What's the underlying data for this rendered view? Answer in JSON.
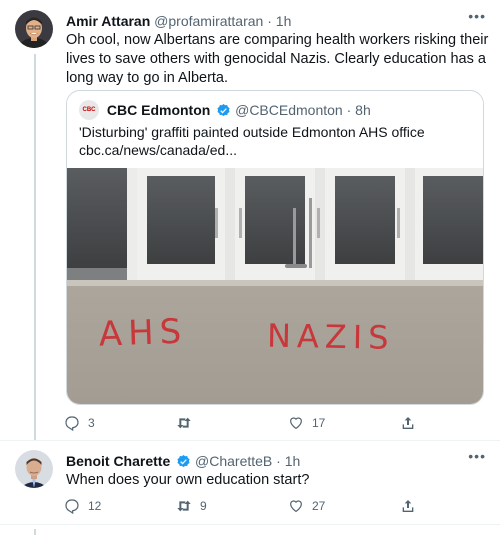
{
  "tweet1": {
    "name": "Amir Attaran",
    "handle": "@profamirattaran",
    "dot": "·",
    "time": "1h",
    "text": "Oh cool, now Albertans are comparing health workers risking their lives to save others with genocidal Nazis.  Clearly education has a long way to go in Alberta.",
    "quote": {
      "logo_text": "CBC",
      "name": "CBC Edmonton",
      "handle": "@CBCEdmonton",
      "dot": "·",
      "time": "8h",
      "title": "'Disturbing' graffiti painted outside Edmonton AHS office",
      "link": "cbc.ca/news/canada/ed...",
      "graffiti_left": "AHS",
      "graffiti_right": "NAZIS"
    },
    "actions": {
      "replies": "3",
      "retweets": "",
      "likes": "17"
    }
  },
  "tweet2": {
    "name": "Benoit Charette",
    "handle": "@CharetteB",
    "dot": "·",
    "time": "1h",
    "text": "When does your own education start?",
    "actions": {
      "replies": "12",
      "retweets": "9",
      "likes": "27"
    }
  },
  "colors": {
    "verified": "#1d9bf0",
    "text_secondary": "#536471",
    "graffiti": "#c8373a"
  }
}
